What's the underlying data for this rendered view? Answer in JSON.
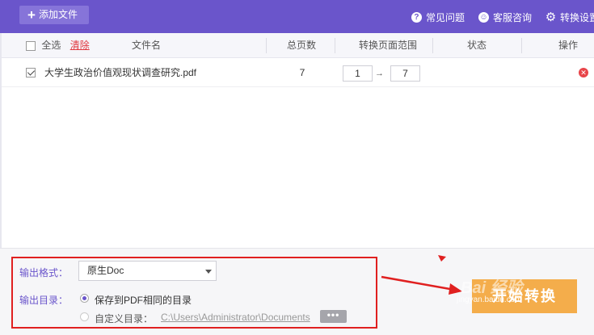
{
  "toolbar": {
    "add_label": "添加文件",
    "links": [
      {
        "icon": "question-circle-icon",
        "label": "常见问题"
      },
      {
        "icon": "chat-smiley-icon",
        "label": "客服咨询"
      },
      {
        "icon": "gear-icon",
        "label": "转换设置"
      }
    ]
  },
  "table": {
    "select_all": "全选",
    "clear": "清除",
    "columns": [
      "文件名",
      "总页数",
      "转换页面范围",
      "状态",
      "操作"
    ],
    "rows": [
      {
        "checked": true,
        "name": "大学生政治价值观现状调查研究.pdf",
        "pages": "7",
        "range_from": "1",
        "range_to": "7",
        "status": ""
      }
    ]
  },
  "output": {
    "format_label": "输出格式：",
    "format_value": "原生Doc",
    "dir_label": "输出目录：",
    "option_same": "保存到PDF相同的目录",
    "option_custom": "自定义目录：",
    "custom_path": "C:\\Users\\Administrator\\Documents",
    "browse_label": "•••"
  },
  "convert_label": "开始转换",
  "watermark": {
    "logo": "Bai 经验",
    "url": "jingyan.baidu.com"
  },
  "colors": {
    "header_purple": "#6a55cb",
    "convert_orange": "#f4ad4b",
    "highlight_red": "#e02020"
  }
}
